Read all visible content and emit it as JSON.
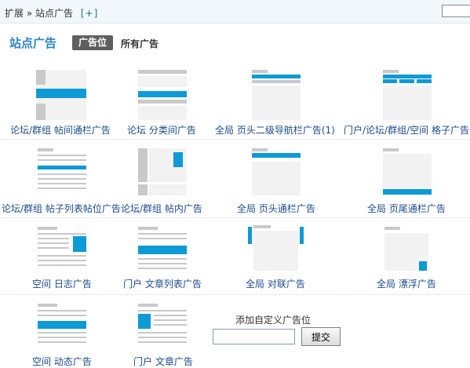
{
  "breadcrumb": {
    "section": "扩展",
    "separator": "»",
    "current": "站点广告",
    "add": "[+]"
  },
  "header": {
    "title": "站点广告",
    "tabs": [
      {
        "label": "广告位",
        "active": true
      },
      {
        "label": "所有广告",
        "active": false
      }
    ]
  },
  "ad_slots": [
    {
      "label": "论坛/群组  帖间通栏广告"
    },
    {
      "label": "论坛  分类间广告"
    },
    {
      "label": "全局  页头二级导航栏广告(1)"
    },
    {
      "label": "门户/论坛/群组/空间  格子广告"
    },
    {
      "label": "论坛/群组  帖子列表帖位广告"
    },
    {
      "label": "论坛/群组  帖内广告"
    },
    {
      "label": "全局  页头通栏广告"
    },
    {
      "label": "全局  页尾通栏广告"
    },
    {
      "label": "空间  日志广告"
    },
    {
      "label": "门户  文章列表广告"
    },
    {
      "label": "全局  对联广告"
    },
    {
      "label": "全局  漂浮广告"
    },
    {
      "label": "空间  动态广告"
    },
    {
      "label": "门户  文章广告"
    }
  ],
  "custom": {
    "title": "添加自定义广告位",
    "input_value": "",
    "submit_label": "提交"
  },
  "colors": {
    "accent": "#0e9ad6",
    "title": "#2b84c9",
    "link": "#1a4b8c"
  }
}
